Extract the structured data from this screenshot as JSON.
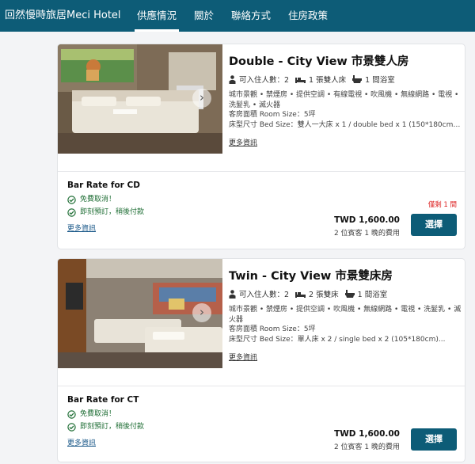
{
  "nav": {
    "brand": "回然慢時旅居Meci Hotel",
    "tabs": [
      {
        "label": "供應情況",
        "active": true
      },
      {
        "label": "關於",
        "active": false
      },
      {
        "label": "聯絡方式",
        "active": false
      },
      {
        "label": "住房政策",
        "active": false
      }
    ]
  },
  "colors": {
    "primary": "#0d5c77",
    "perk_green": "#1f6e35",
    "warning_red": "#dd2222"
  },
  "rooms": [
    {
      "title": "Double - City View 市景雙人房",
      "guests": "可入住人數：2",
      "beds": "1 張雙人床",
      "bath": "1 間浴室",
      "amenities": "城市景觀 • 禁煙房 • 提供空調 • 有線電視 • 吹風機 • 無線網路 • 電視 • 洗髮乳 • 滅火器",
      "size": "客房面積 Room Size：5坪",
      "bed_size": "床型尺寸 Bed Size：雙人一大床 x 1 / double bed x 1 (150*180cm)...",
      "more": "更多資訊",
      "rate_name": "Bar Rate for CD",
      "perk1": "免費取消！",
      "perk2": "即刻預訂，稍後付款",
      "rate_more": "更多資訊",
      "remaining": "僅剩 1 間",
      "price": "TWD 1,600.00",
      "price_sub": "2 位賓客 1 晚的費用",
      "book": "選擇"
    },
    {
      "title": "Twin - City View 市景雙床房",
      "guests": "可入住人數：2",
      "beds": "2 張雙床",
      "bath": "1 間浴室",
      "amenities": "城市景觀 • 禁煙房 • 提供空調 • 吹風機 • 無線網路 • 電視 • 洗髮乳 • 滅火器",
      "size": "客房面積 Room Size：5坪",
      "bed_size": "床型尺寸 Bed Size：單人床 x 2 / single bed x 2 (105*180cm)...",
      "more": "更多資訊",
      "rate_name": "Bar Rate for CT",
      "perk1": "免費取消！",
      "perk2": "即刻預訂，稍後付款",
      "rate_more": "更多資訊",
      "price": "TWD 1,600.00",
      "price_sub": "2 位賓客 1 晚的費用",
      "book": "選擇"
    }
  ]
}
